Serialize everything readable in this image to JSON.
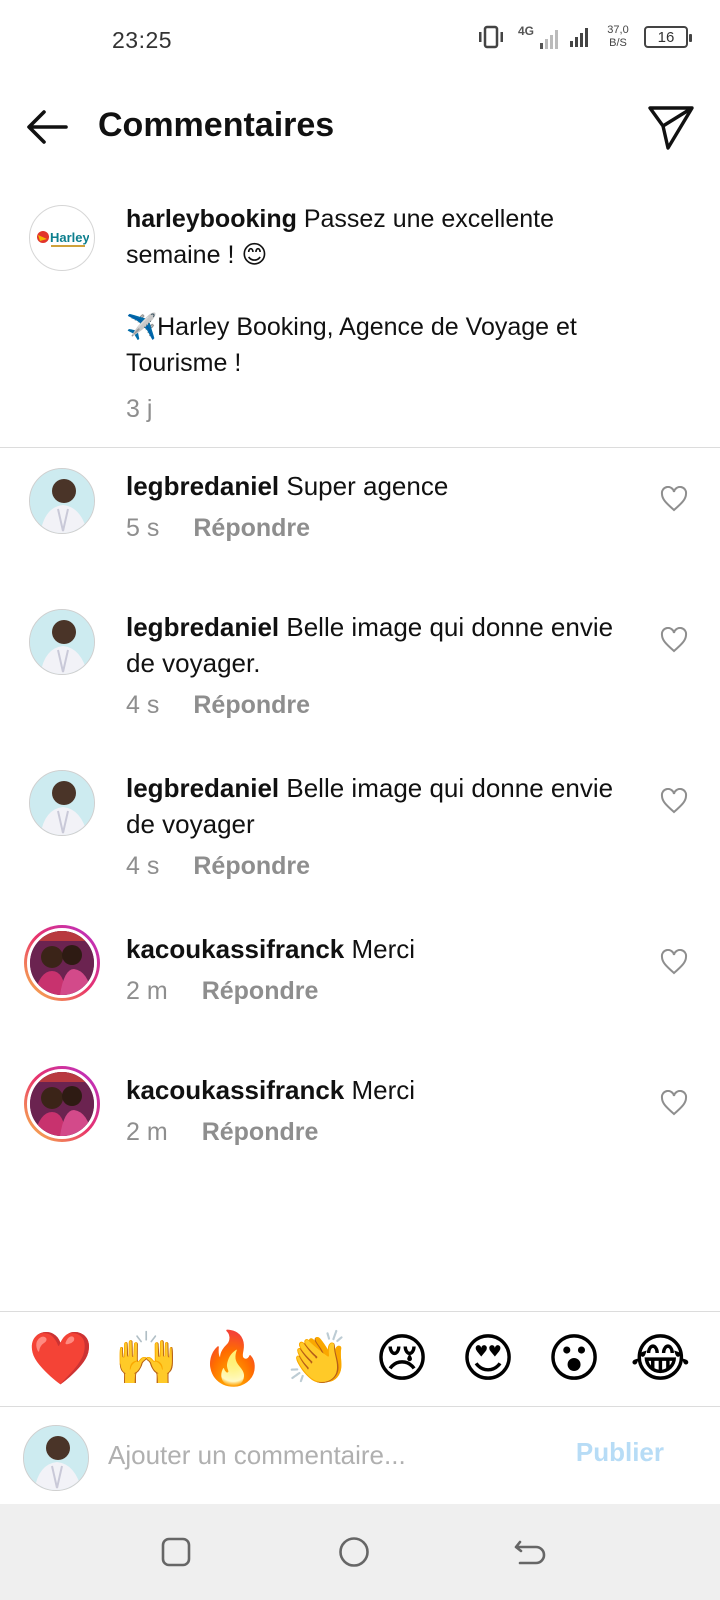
{
  "status_bar": {
    "time": "23:25",
    "network_type": "4G",
    "net_speed_value": "37,0",
    "net_speed_unit": "B/S",
    "battery": "16"
  },
  "header": {
    "title": "Commentaires",
    "back_icon": "arrow-left-icon",
    "send_icon": "paper-plane-icon"
  },
  "caption": {
    "username": "harleybooking",
    "text_line1": " Passez une excellente semaine ! 😊",
    "text_line2": "✈️Harley Booking, Agence de Voyage et Tourisme !",
    "time": "3 j",
    "logo_text": "Harley"
  },
  "comments": [
    {
      "username": "legbredaniel",
      "text": " Super agence",
      "time": "5 s",
      "reply": "Répondre"
    },
    {
      "username": "legbredaniel",
      "text": " Belle image qui donne envie de voyager.",
      "time": "4 s",
      "reply": "Répondre"
    },
    {
      "username": "legbredaniel",
      "text": " Belle image qui donne envie de voyager",
      "time": "4 s",
      "reply": "Répondre"
    },
    {
      "username": "kacoukassifranck",
      "text": " Merci",
      "time": "2 m",
      "reply": "Répondre"
    },
    {
      "username": "kacoukassifranck",
      "text": " Merci",
      "time": "2 m",
      "reply": "Répondre"
    }
  ],
  "emoji_bar": [
    "❤️",
    "🙌",
    "🔥",
    "👏",
    "😢",
    "😍",
    "😮",
    "😂"
  ],
  "input": {
    "placeholder": "Ajouter un commentaire...",
    "publish": "Publier"
  },
  "colors": {
    "meta_gray": "#8e8e8e",
    "publish_disabled": "#b7dcf6",
    "divider": "#dcdcdc",
    "story_ring": "#e8336b"
  }
}
